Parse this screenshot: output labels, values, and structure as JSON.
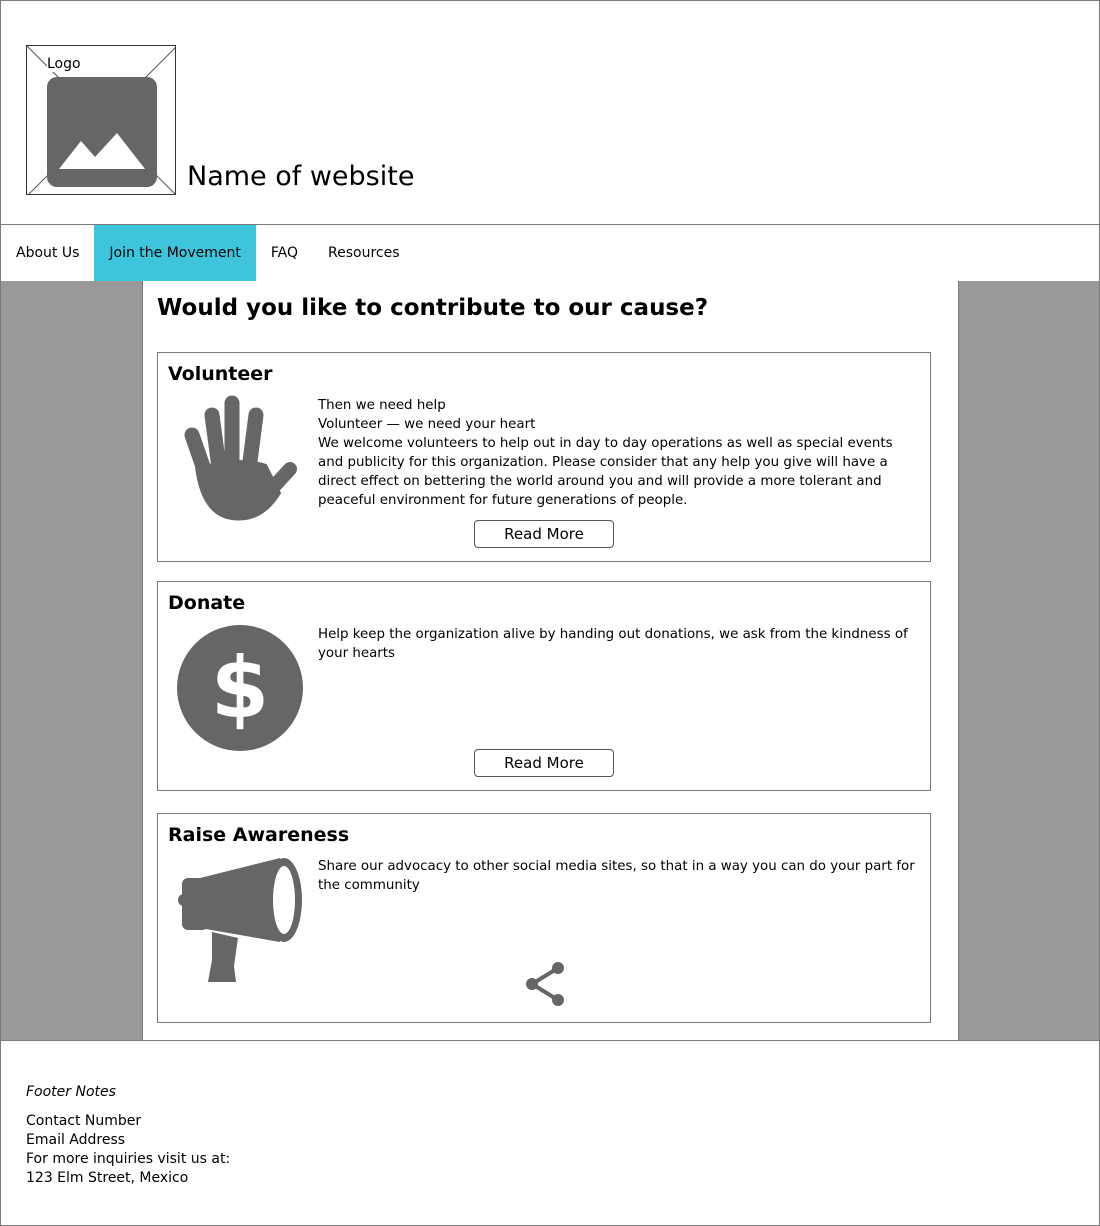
{
  "header": {
    "logo_label": "Logo",
    "site_name": "Name of website"
  },
  "nav": {
    "items": [
      {
        "label": "About Us",
        "active": false
      },
      {
        "label": "Join the Movement",
        "active": true
      },
      {
        "label": "FAQ",
        "active": false
      },
      {
        "label": "Resources",
        "active": false
      }
    ],
    "active_color": "#3ec5db"
  },
  "main": {
    "title": "Would you like to contribute to our cause?",
    "cards": [
      {
        "title": "Volunteer",
        "icon": "hand-icon",
        "lines": [
          "Then we need help",
          "Volunteer — we need your heart",
          "We welcome volunteers to help out in day to day operations as well as special events and publicity for this organization. Please consider that any help you give will have a direct effect on bettering the world around you and will provide a more tolerant and peaceful environment for future generations of people."
        ],
        "button_label": "Read More"
      },
      {
        "title": "Donate",
        "icon": "dollar-icon",
        "lines": [
          "Help keep the organization alive by handing out donations, we ask from the kindness of your hearts"
        ],
        "button_label": "Read More"
      },
      {
        "title": "Raise Awareness",
        "icon": "megaphone-icon",
        "lines": [
          "Share our advocacy to other social media sites, so that in a  way you can do your part for the community"
        ],
        "action_icon": "share-icon"
      }
    ]
  },
  "footer": {
    "notes_label": "Footer Notes",
    "contact_number": "Contact Number",
    "email_address": "Email Address",
    "inquiries": "For more inquiries visit us at:",
    "address": "123 Elm Street, Mexico"
  },
  "colors": {
    "icon_gray": "#666666",
    "background_gray": "#999999"
  }
}
